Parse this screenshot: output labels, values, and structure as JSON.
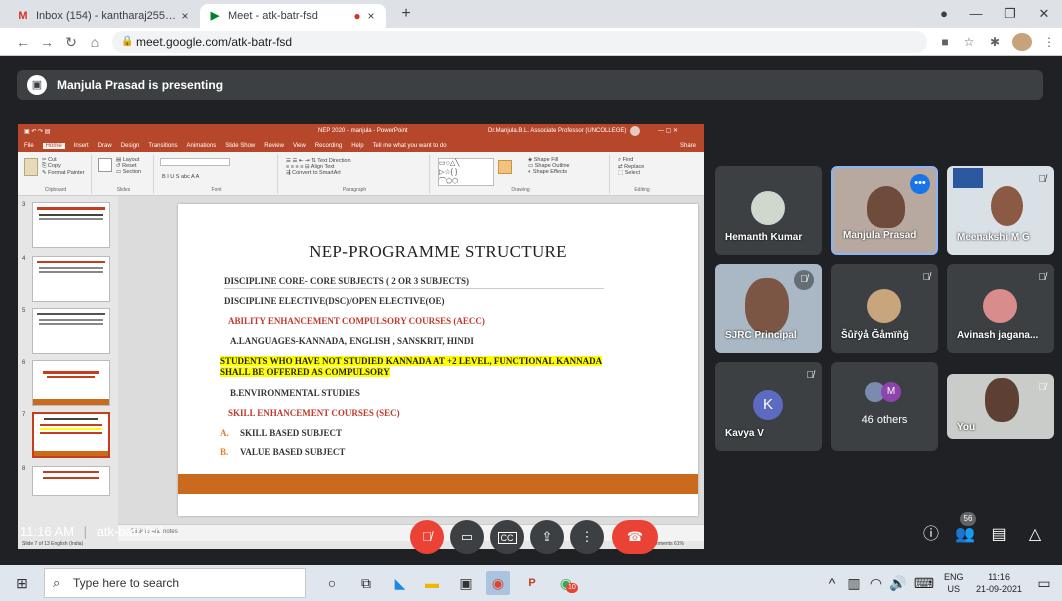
{
  "browser": {
    "tabs": [
      {
        "icon": "M",
        "title": "Inbox (154) - kantharaj2553@gm",
        "close": "×"
      },
      {
        "icon": "▶",
        "title": "Meet - atk-batr-fsd",
        "close": "×",
        "recording": "●"
      }
    ],
    "new_tab": "+",
    "url": "meet.google.com/atk-batr-fsd"
  },
  "meet": {
    "presenter_banner": "Manjula Prasad is presenting",
    "time": "11:16 AM",
    "separator": "|",
    "meeting_code": "atk-batr-fsd",
    "participant_count": "56",
    "others_label": "46 others",
    "colors": {
      "end_call": "#ea4335",
      "mic_off": "#ea4335",
      "active_speaker": "#8ab4f8"
    }
  },
  "participants": [
    {
      "name": "Hemanth Kumar"
    },
    {
      "name": "Manjula Prasad"
    },
    {
      "name": "Meenakshi M G"
    },
    {
      "name": "SJRC Principal"
    },
    {
      "name": "Šůřÿå Ğåmïňğ"
    },
    {
      "name": "Avinash jagana..."
    },
    {
      "name": "Kavya V",
      "initial": "K"
    },
    {
      "name": "You"
    }
  ],
  "others_initial": "M",
  "powerpoint": {
    "title_bar": "NEP 2020 - manjula - PowerPoint",
    "user": "Dr.Manjula.B.L. Associate Professor (UNCOLLEGE)",
    "search": "Tell me what you want to do",
    "share": "Share",
    "menu": [
      "File",
      "Home",
      "Insert",
      "Draw",
      "Design",
      "Transitions",
      "Animations",
      "Slide Show",
      "Review",
      "View",
      "Recording",
      "Help"
    ],
    "ribbon_groups": [
      "Clipboard",
      "Slides",
      "Font",
      "Paragraph",
      "Drawing",
      "Editing"
    ],
    "thumb_numbers": [
      "3",
      "4",
      "5",
      "6",
      "7",
      "8"
    ],
    "notes_placeholder": "Click to add notes",
    "status_left": "Slide 7 of 13   English (India)",
    "status_right": "Notes   Comments   61%"
  },
  "slide": {
    "title": "NEP-PROGRAMME STRUCTURE",
    "line1": "DISCIPLINE CORE- CORE SUBJECTS ( 2 OR 3 SUBJECTS)",
    "line2": "DISCIPLINE ELECTIVE(DSC)/OPEN ELECTIVE(OE)",
    "line3": "ABILITY ENHANCEMENT COMPULSORY COURSES (AECC)",
    "line4": "A.LANGUAGES-KANNADA, ENGLISH , SANSKRIT, HINDI",
    "line5a": "STUDENTS WHO HAVE NOT STUDIED KANNADA  AT  +2 LEVEL, FUNCTIONAL KANNADA",
    "line5b": "SHALL BE OFFERED AS COMPULSORY",
    "line6": "B.ENVIRONMENTAL STUDIES",
    "line7": "SKILL ENHANCEMENT COURSES (SEC)",
    "itemA_marker": "A.",
    "itemA": "SKILL BASED SUBJECT",
    "itemB_marker": "B.",
    "itemB": "VALUE BASED SUBJECT"
  },
  "taskbar": {
    "search_placeholder": "Type here to search",
    "lang": "ENG",
    "region": "US",
    "time": "11:16",
    "date": "21-09-2021",
    "badge": "10"
  }
}
